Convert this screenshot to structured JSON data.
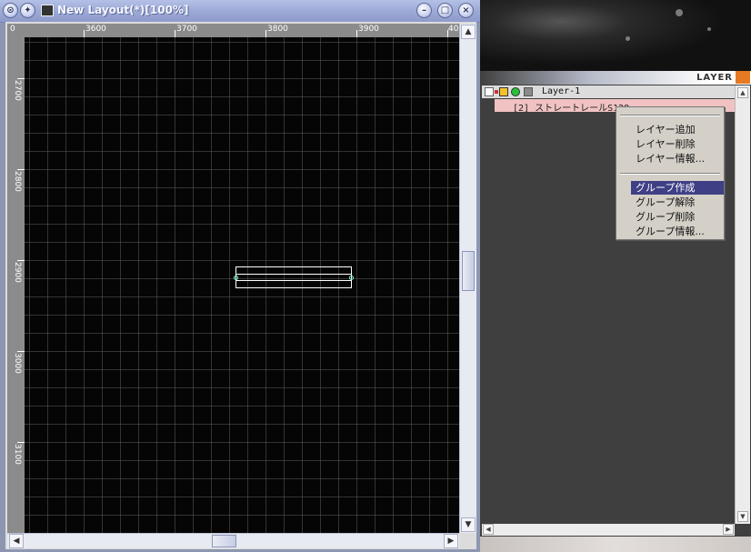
{
  "window": {
    "title": "New Layout(*)[100%]",
    "buttons": {
      "minimize": "–",
      "maximize": "□",
      "close": "×"
    }
  },
  "rulers": {
    "horizontal": [
      "0",
      "3600",
      "3700",
      "3800",
      "3900",
      "40"
    ],
    "vertical": [
      "2700",
      "2800",
      "2900",
      "3000",
      "3100"
    ]
  },
  "layer_panel": {
    "title": "LAYER",
    "layer_name": "Layer-1",
    "sublayer_name": "[2] ストレートレールS128"
  },
  "context_menu": {
    "group1": [
      "レイヤー追加",
      "レイヤー削除",
      "レイヤー情報..."
    ],
    "group2": [
      "グループ作成",
      "グループ解除",
      "グループ削除",
      "グループ情報..."
    ],
    "highlighted": "グループ作成"
  },
  "colors": {
    "titlebar": "#9daad6",
    "canvas": "#050505",
    "menu_highlight": "#3f3f86",
    "sublayer_highlight": "#f1c2c2",
    "accent": "#e67a22"
  }
}
